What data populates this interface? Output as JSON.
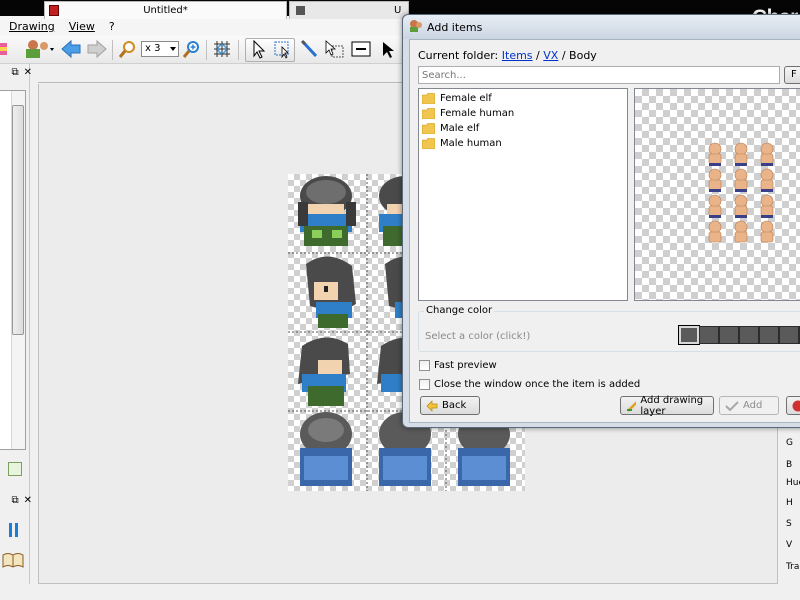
{
  "app": {
    "title": "Char"
  },
  "menu": {
    "items": [
      "Drawing",
      "View",
      "?"
    ]
  },
  "toolbar": {
    "zoom_value": "x 3"
  },
  "tabs": [
    {
      "label": "Untitled*"
    },
    {
      "label": "U"
    }
  ],
  "dialog": {
    "title": "Add items",
    "current_folder_label": "Current folder:",
    "path": [
      "Items",
      "VX"
    ],
    "path_tail": "Body",
    "path_sep": "/",
    "search_placeholder": "Search...",
    "search_button_label": "F",
    "folders": [
      "Female elf",
      "Female human",
      "Male elf",
      "Male human"
    ],
    "change_color_label": "Change color",
    "color_hint": "Select a color (click!)",
    "swatch_color": "#5a5a5a",
    "swatch_count": 7,
    "fast_preview_label": "Fast preview",
    "close_window_label": "Close the window once the item is added",
    "back_button": "Back",
    "add_layer_button": "Add drawing layer",
    "add_button": "Add"
  },
  "right_panel": {
    "labels": [
      "G",
      "B",
      "Hue",
      "H",
      "S",
      "V",
      "Tra"
    ]
  }
}
